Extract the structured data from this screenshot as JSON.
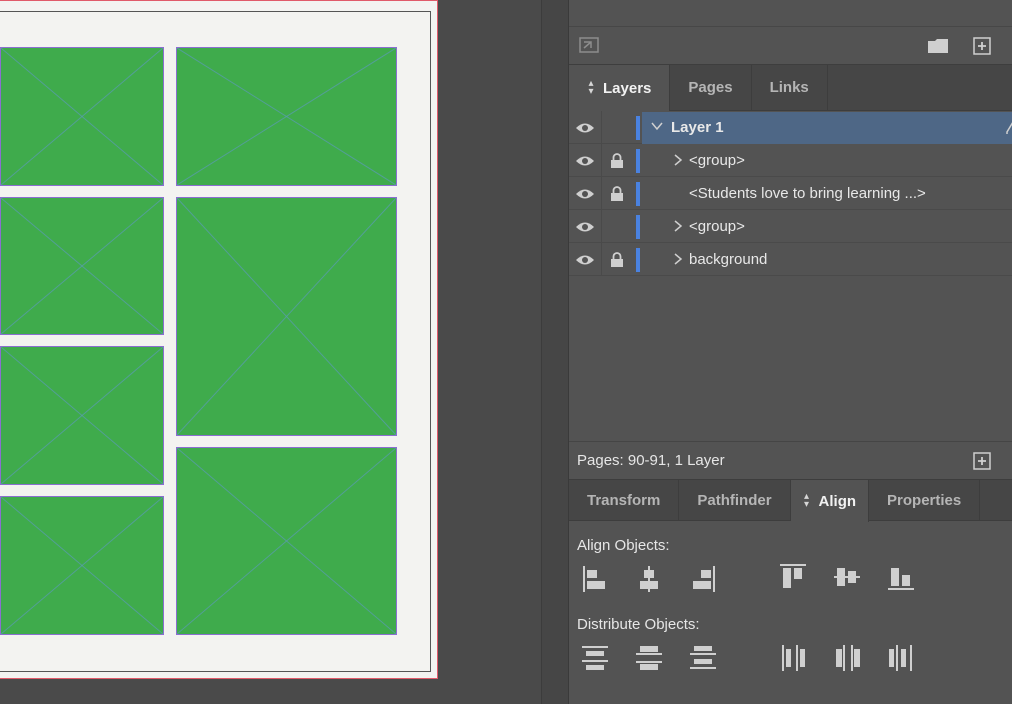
{
  "layers_panel": {
    "tabs": [
      {
        "label": "Layers",
        "active": true
      },
      {
        "label": "Pages",
        "active": false
      },
      {
        "label": "Links",
        "active": false
      }
    ],
    "rows": [
      {
        "name": "Layer 1",
        "expanded": true,
        "locked": false,
        "selected": true
      },
      {
        "name": "<group>",
        "expandable": true,
        "locked": true
      },
      {
        "name": "<Students love to bring learning ...>",
        "expandable": false,
        "locked": true
      },
      {
        "name": "<group>",
        "expandable": true,
        "locked": false
      },
      {
        "name": "background",
        "expandable": true,
        "locked": true
      }
    ],
    "footer_text": "Pages: 90-91, 1 Layer"
  },
  "bottom_panel": {
    "tabs": [
      {
        "label": "Transform",
        "active": false
      },
      {
        "label": "Pathfinder",
        "active": false
      },
      {
        "label": "Align",
        "active": true
      },
      {
        "label": "Properties",
        "active": false
      }
    ],
    "align_objects_label": "Align Objects:",
    "distribute_objects_label": "Distribute Objects:"
  },
  "icons": {
    "toolbar": [
      "place-icon",
      "folder-icon",
      "new-page-icon"
    ],
    "layer_row": [
      "visibility-eye-icon",
      "lock-icon",
      "chevron-right-icon",
      "chevron-down-icon"
    ],
    "align": [
      "align-left-edges-icon",
      "align-horizontal-centers-icon",
      "align-right-edges-icon",
      "align-top-edges-icon",
      "align-vertical-centers-icon",
      "align-bottom-edges-icon"
    ],
    "distribute": [
      "distribute-top-edges-icon",
      "distribute-vertical-centers-icon",
      "distribute-bottom-edges-icon",
      "distribute-left-edges-icon",
      "distribute-horizontal-centers-icon",
      "distribute-right-edges-icon"
    ]
  },
  "colors": {
    "frame_fill": "#3fab4c",
    "layer_color": "#4a82e0",
    "selection": "#4e6786",
    "bleed_guide": "#e05a6a"
  }
}
